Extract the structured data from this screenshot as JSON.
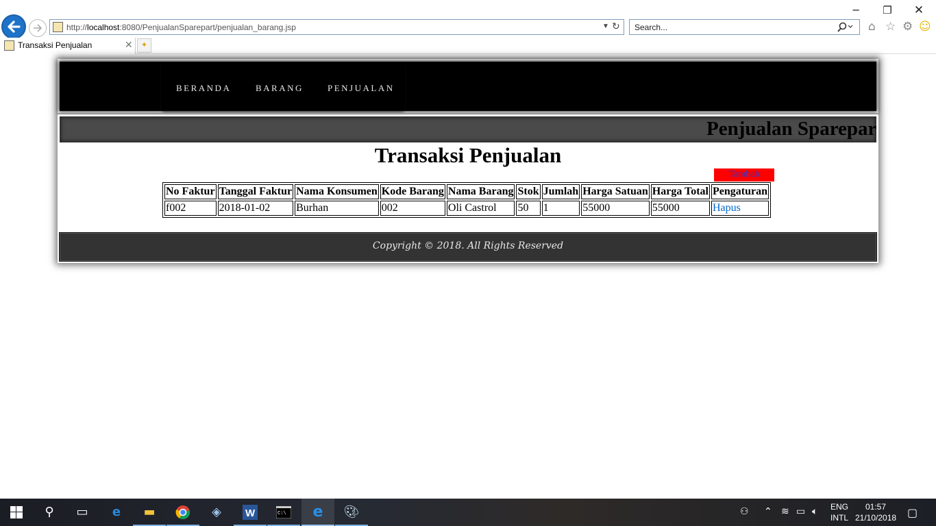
{
  "window": {
    "minimize": "─",
    "restore": "❐",
    "close": "✕"
  },
  "browser": {
    "url_prefix": "http://",
    "url_host": "localhost",
    "url_rest": ":8080/PenjualanSparepart/penjualan_barang.jsp",
    "search_placeholder": "Search...",
    "tab_title": "Transaksi Penjualan",
    "icons": [
      "back-icon",
      "forward-icon",
      "refresh-icon",
      "search-icon",
      "home-icon",
      "favorites-star-icon",
      "settings-gear-icon",
      "smiley-feedback-icon"
    ]
  },
  "site": {
    "menu": [
      "BERANDA",
      "BARANG",
      "PENJUALAN"
    ],
    "marquee": "Penjualan Sparepart",
    "page_title": "Transaksi Penjualan",
    "add_button": "Tambah",
    "table": {
      "headers": [
        "No Faktur",
        "Tanggal Faktur",
        "Nama Konsumen",
        "Kode Barang",
        "Nama Barang",
        "Stok",
        "Jumlah",
        "Harga Satuan",
        "Harga Total",
        "Pengaturan"
      ],
      "rows": [
        [
          "f002",
          "2018-01-02",
          "Burhan",
          "002",
          "Oli Castrol",
          "50",
          "1",
          "55000",
          "55000",
          "Hapus"
        ]
      ]
    },
    "footer": "Copyright © 2018. All Rights Reserved",
    "colors": {
      "header_bg": "#000000",
      "marquee_bg": "#4a4a4a",
      "add_button_bg": "#ff0000",
      "add_button_text": "#3333cc",
      "link": "#0066cc",
      "footer_bg": "#333333"
    }
  },
  "taskbar": {
    "apps": [
      "windows-start-icon",
      "search-icon",
      "task-view-icon",
      "edge-icon",
      "file-explorer-icon",
      "chrome-icon",
      "virtualbox-icon",
      "word-icon",
      "cmd-icon",
      "internet-explorer-icon",
      "paint-icon"
    ],
    "lang_top": "ENG",
    "lang_bottom": "INTL",
    "time": "01:57",
    "date": "21/10/2018"
  }
}
